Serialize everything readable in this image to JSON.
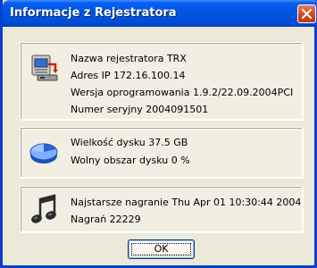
{
  "window": {
    "title": "Informacje z Rejestratora"
  },
  "icons": {
    "close": "close-icon",
    "recorder": "computer-recorder-icon",
    "disk": "disk-pie-icon",
    "music": "music-note-icon"
  },
  "recorder_info": {
    "name": "Nazwa rejestratora TRX",
    "ip": "Adres IP 172.16.100.14",
    "firmware": "Wersja oprogramowania 1.9.2/22.09.2004PCI",
    "serial": "Numer seryjny 2004091501"
  },
  "disk_info": {
    "size": "Wielkość dysku 37.5 GB",
    "free": "Wolny obszar dysku 0 %"
  },
  "recordings_info": {
    "oldest": "Najstarsze nagranie Thu Apr 01 10:30:44 2004",
    "count": "Nagrań 22229"
  },
  "buttons": {
    "ok": "OK"
  },
  "colors": {
    "titlebar": "#0054e3",
    "dialog_bg": "#ece9d8",
    "close_button": "#d3431b"
  }
}
